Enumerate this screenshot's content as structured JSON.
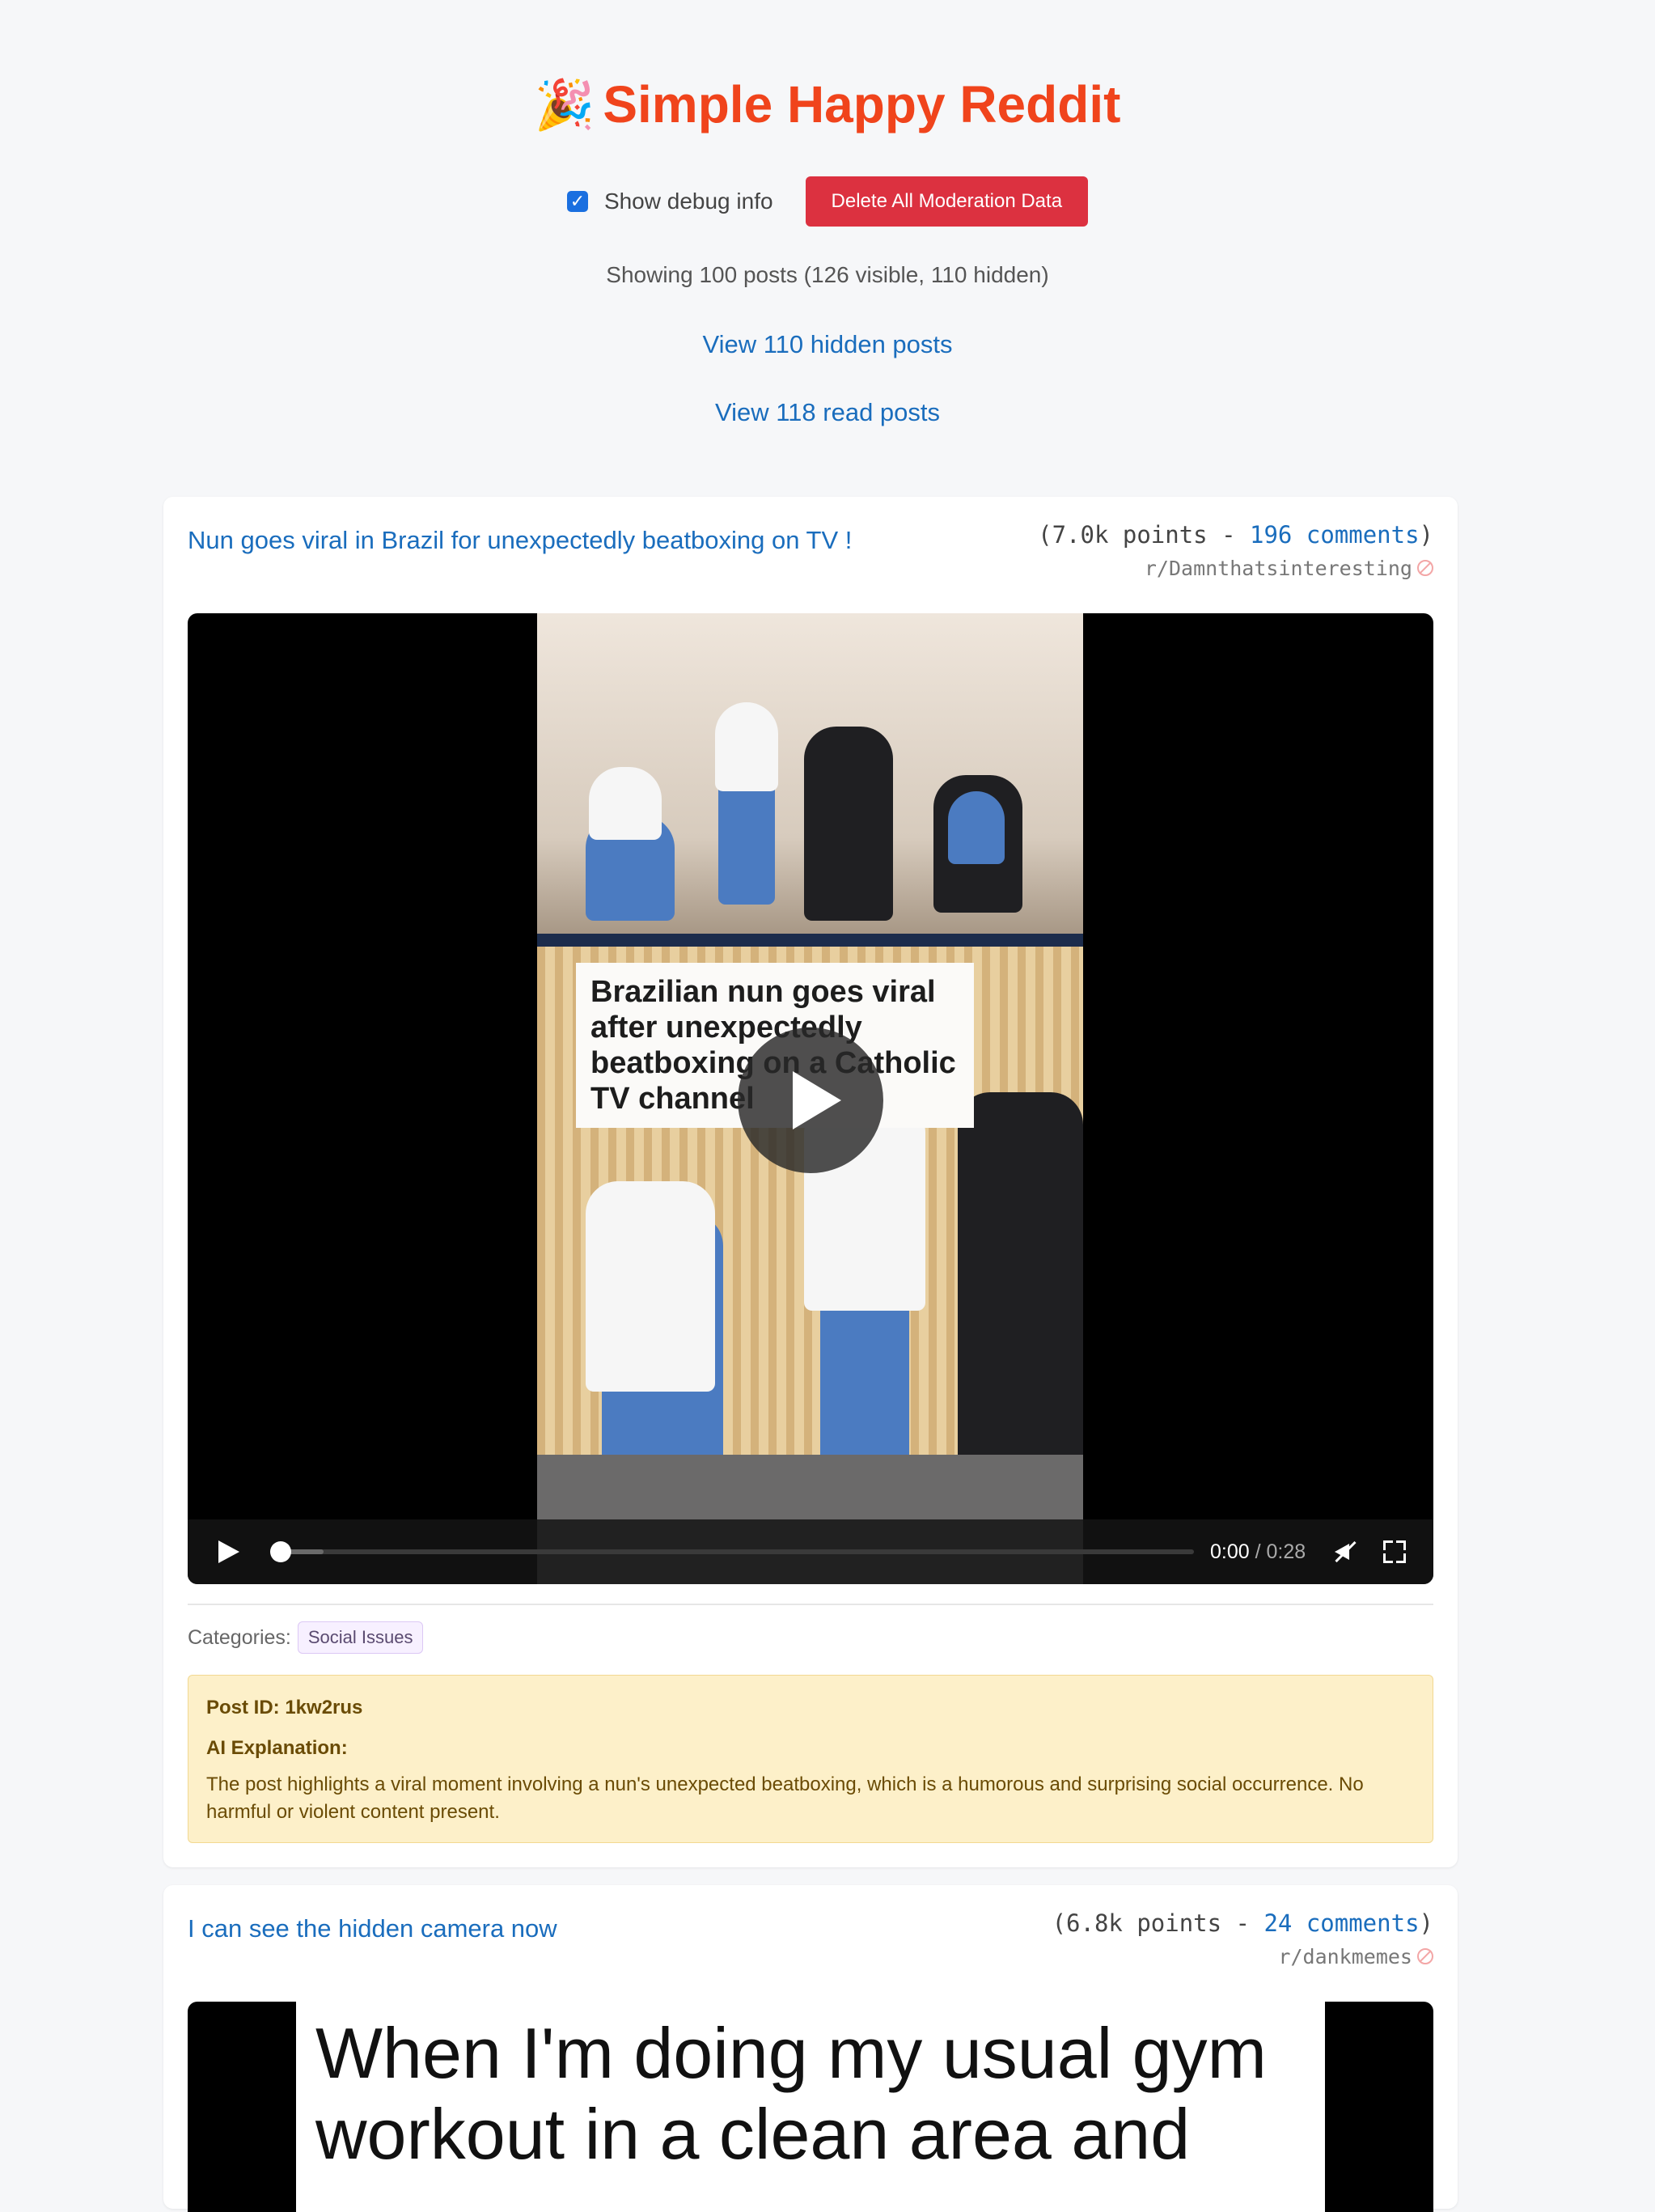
{
  "app": {
    "icon": "party-popper-icon",
    "icon_glyph": "🎉",
    "title": "Simple Happy Reddit",
    "accent_color": "#f0441c"
  },
  "controls": {
    "debug_checkbox_checked": true,
    "debug_checkbox_label": "Show debug info",
    "delete_button_label": "Delete All Moderation Data"
  },
  "status": {
    "showing_text": "Showing 100 posts (126 visible, 110 hidden)",
    "view_hidden_link": "View 110 hidden posts",
    "view_read_link": "View 118 read posts"
  },
  "posts": [
    {
      "title": "Nun goes viral in Brazil for unexpectedly beatboxing on TV !",
      "points_prefix": "(7.0k points - ",
      "comments": "196 comments",
      "points_suffix": ")",
      "subreddit": "r/Damnthatsinteresting",
      "video": {
        "caption_text": "Brazilian nun goes viral after unexpectedly beatboxing on a Catholic TV channel",
        "current_time": "0:00",
        "duration": "/ 0:28",
        "progress": 0
      },
      "categories_label": "Categories:",
      "categories": [
        "Social Issues"
      ],
      "debug": {
        "post_id": "Post ID: 1kw2rus",
        "ai_label": "AI Explanation:",
        "ai_explanation": "The post highlights a viral moment involving a nun's unexpected beatboxing, which is a humorous and surprising social occurrence. No harmful or violent content present."
      }
    },
    {
      "title": "I can see the hidden camera now",
      "points_prefix": "(6.8k points - ",
      "comments": "24 comments",
      "points_suffix": ")",
      "subreddit": "r/dankmemes",
      "image_text": "When I'm doing my usual gym workout in a clean area and"
    }
  ]
}
